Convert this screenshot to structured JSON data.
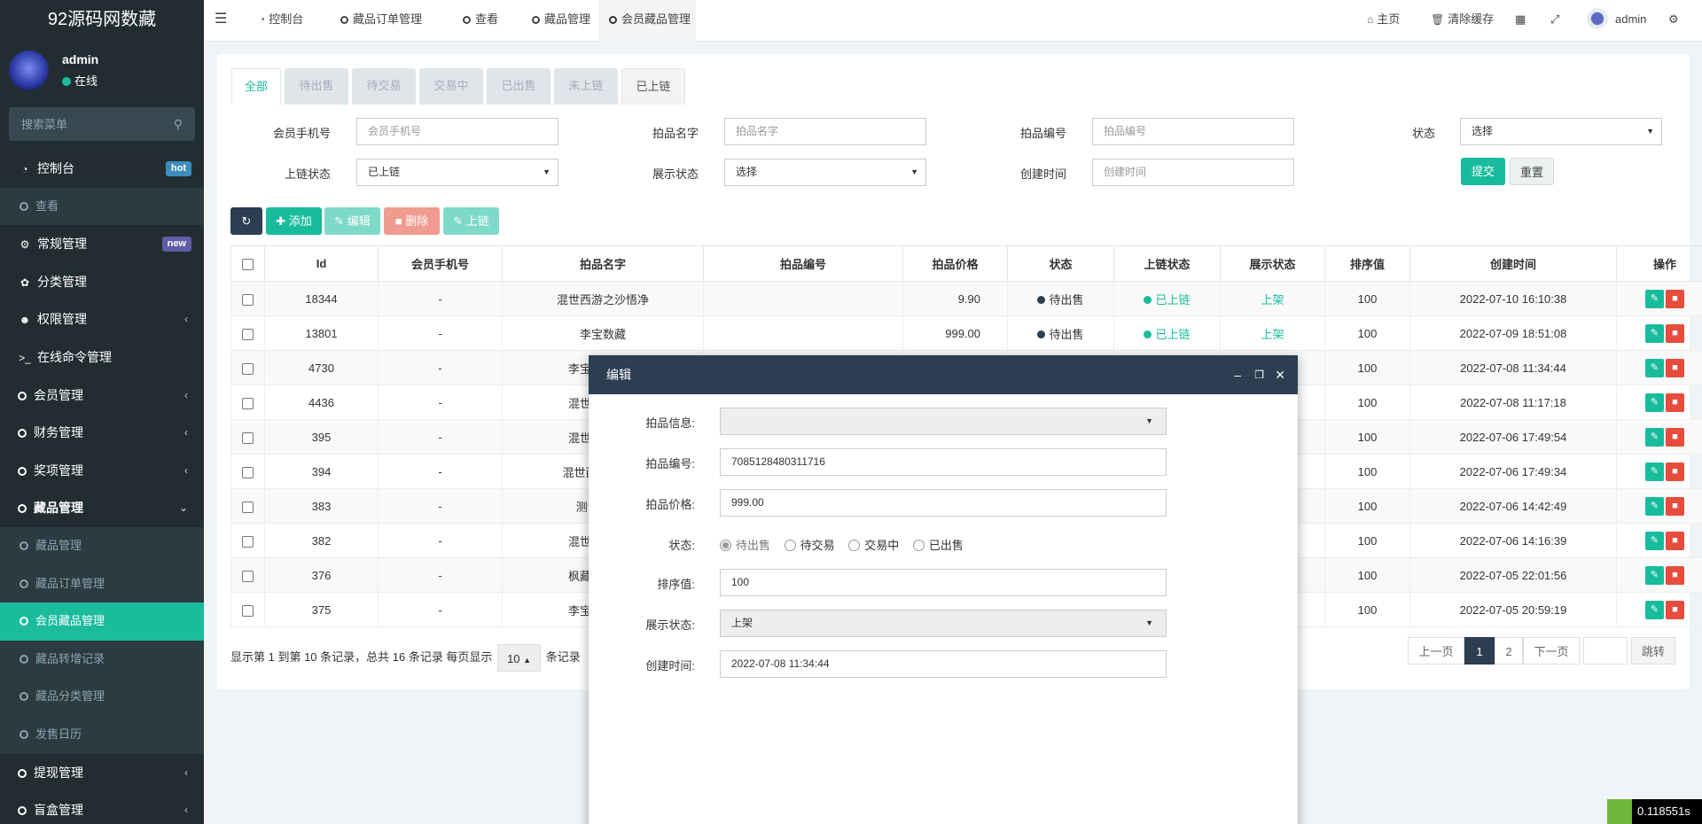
{
  "app": {
    "title": "92源码网数藏"
  },
  "user": {
    "name": "admin",
    "status": "在线"
  },
  "sidebar": {
    "search_placeholder": "搜索菜单",
    "items": [
      {
        "label": "控制台",
        "badge": "hot",
        "badge_color": "#3c8dbc"
      },
      {
        "label": "查看"
      },
      {
        "label": "常规管理",
        "badge": "new",
        "badge_color": "#605ca8"
      },
      {
        "label": "分类管理"
      },
      {
        "label": "权限管理"
      },
      {
        "label": "在线命令管理"
      },
      {
        "label": "会员管理"
      },
      {
        "label": "财务管理"
      },
      {
        "label": "奖项管理"
      },
      {
        "label": "藏品管理"
      },
      {
        "label": "藏品管理"
      },
      {
        "label": "藏品订单管理"
      },
      {
        "label": "会员藏品管理"
      },
      {
        "label": "藏品转增记录"
      },
      {
        "label": "藏品分类管理"
      },
      {
        "label": "发售日历"
      },
      {
        "label": "提现管理"
      },
      {
        "label": "盲盒管理"
      }
    ]
  },
  "topnav": {
    "tabs": [
      "控制台",
      "藏品订单管理",
      "查看",
      "藏品管理",
      "会员藏品管理"
    ],
    "home": "主页",
    "clear_cache": "清除缓存",
    "admin": "admin"
  },
  "status_tabs": [
    "全部",
    "待出售",
    "待交易",
    "交易中",
    "已出售",
    "未上链",
    "已上链"
  ],
  "filters": {
    "phone_label": "会员手机号",
    "phone_placeholder": "会员手机号",
    "name_label": "拍品名字",
    "name_placeholder": "拍品名字",
    "code_label": "拍品编号",
    "code_placeholder": "拍品编号",
    "status_label": "状态",
    "status_value": "选择",
    "chain_label": "上链状态",
    "chain_value": "已上链",
    "show_label": "展示状态",
    "show_value": "选择",
    "time_label": "创建时间",
    "time_placeholder": "创建时间",
    "submit": "提交",
    "reset": "重置"
  },
  "toolbar": {
    "add": "添加",
    "edit": "编辑",
    "delete": "删除",
    "chain": "上链"
  },
  "table": {
    "headers": [
      "Id",
      "会员手机号",
      "拍品名字",
      "拍品编号",
      "拍品价格",
      "状态",
      "上链状态",
      "展示状态",
      "排序值",
      "创建时间",
      "操作"
    ],
    "rows": [
      {
        "id": "18344",
        "phone": "-",
        "name": "混世西游之沙悟净",
        "code": "",
        "price": "9.90",
        "status": "待出售",
        "chain": "已上链",
        "show": "上架",
        "sort": "100",
        "time": "2022-07-10 16:10:38"
      },
      {
        "id": "13801",
        "phone": "-",
        "name": "李宝数藏",
        "code": "",
        "price": "999.00",
        "status": "待出售",
        "chain": "已上链",
        "show": "上架",
        "sort": "100",
        "time": "2022-07-09 18:51:08"
      },
      {
        "id": "4730",
        "phone": "-",
        "name": "李宝数藏纪念",
        "code": "",
        "price": "",
        "status": "",
        "chain": "",
        "show": "",
        "sort": "100",
        "time": "2022-07-08 11:34:44"
      },
      {
        "id": "4436",
        "phone": "-",
        "name": "混世西游之牛",
        "code": "",
        "price": "",
        "status": "",
        "chain": "",
        "show": "",
        "sort": "100",
        "time": "2022-07-08 11:17:18"
      },
      {
        "id": "395",
        "phone": "-",
        "name": "混世西游之牛",
        "code": "",
        "price": "",
        "status": "",
        "chain": "",
        "show": "",
        "sort": "100",
        "time": "2022-07-06 17:49:54"
      },
      {
        "id": "394",
        "phone": "-",
        "name": "混世西游之铁扇",
        "code": "",
        "price": "",
        "status": "",
        "chain": "",
        "show": "",
        "sort": "100",
        "time": "2022-07-06 17:49:34"
      },
      {
        "id": "383",
        "phone": "-",
        "name": "测试勿买--",
        "code": "",
        "price": "",
        "status": "",
        "chain": "",
        "show": "",
        "sort": "100",
        "time": "2022-07-06 14:42:49"
      },
      {
        "id": "382",
        "phone": "-",
        "name": "混世西游之沙",
        "code": "",
        "price": "",
        "status": "",
        "chain": "",
        "show": "",
        "sort": "100",
        "time": "2022-07-06 14:16:39"
      },
      {
        "id": "376",
        "phone": "-",
        "name": "枫藏辟地纪念",
        "code": "",
        "price": "",
        "status": "",
        "chain": "",
        "show": "",
        "sort": "100",
        "time": "2022-07-05 22:01:56"
      },
      {
        "id": "375",
        "phone": "-",
        "name": "李宝数藏纪念",
        "code": "",
        "price": "",
        "status": "",
        "chain": "",
        "show": "",
        "sort": "100",
        "time": "2022-07-05 20:59:19"
      }
    ]
  },
  "pagination": {
    "info": "显示第 1 到第 10 条记录，总共 16 条记录 每页显示",
    "page_size": "10",
    "suffix": "条记录",
    "prev": "上一页",
    "next": "下一页",
    "pages": [
      "1",
      "2"
    ],
    "jump": "跳转"
  },
  "modal": {
    "title": "编辑",
    "info_label": "拍品信息:",
    "info_value": "",
    "code_label": "拍品编号:",
    "code_value": "7085128480311716",
    "price_label": "拍品价格:",
    "price_value": "999.00",
    "status_label": "状态:",
    "status_options": [
      "待出售",
      "待交易",
      "交易中",
      "已出售"
    ],
    "sort_label": "排序值:",
    "sort_value": "100",
    "show_label": "展示状态:",
    "show_value": "上架",
    "time_label": "创建时间:",
    "time_value": "2022-07-08 11:34:44"
  },
  "debug": {
    "time": "0.118551s"
  },
  "colors": {
    "sidebar_bg": "#222d32",
    "accent": "#18bc9c",
    "dark": "#2c3e50",
    "danger": "#e74c3c"
  }
}
